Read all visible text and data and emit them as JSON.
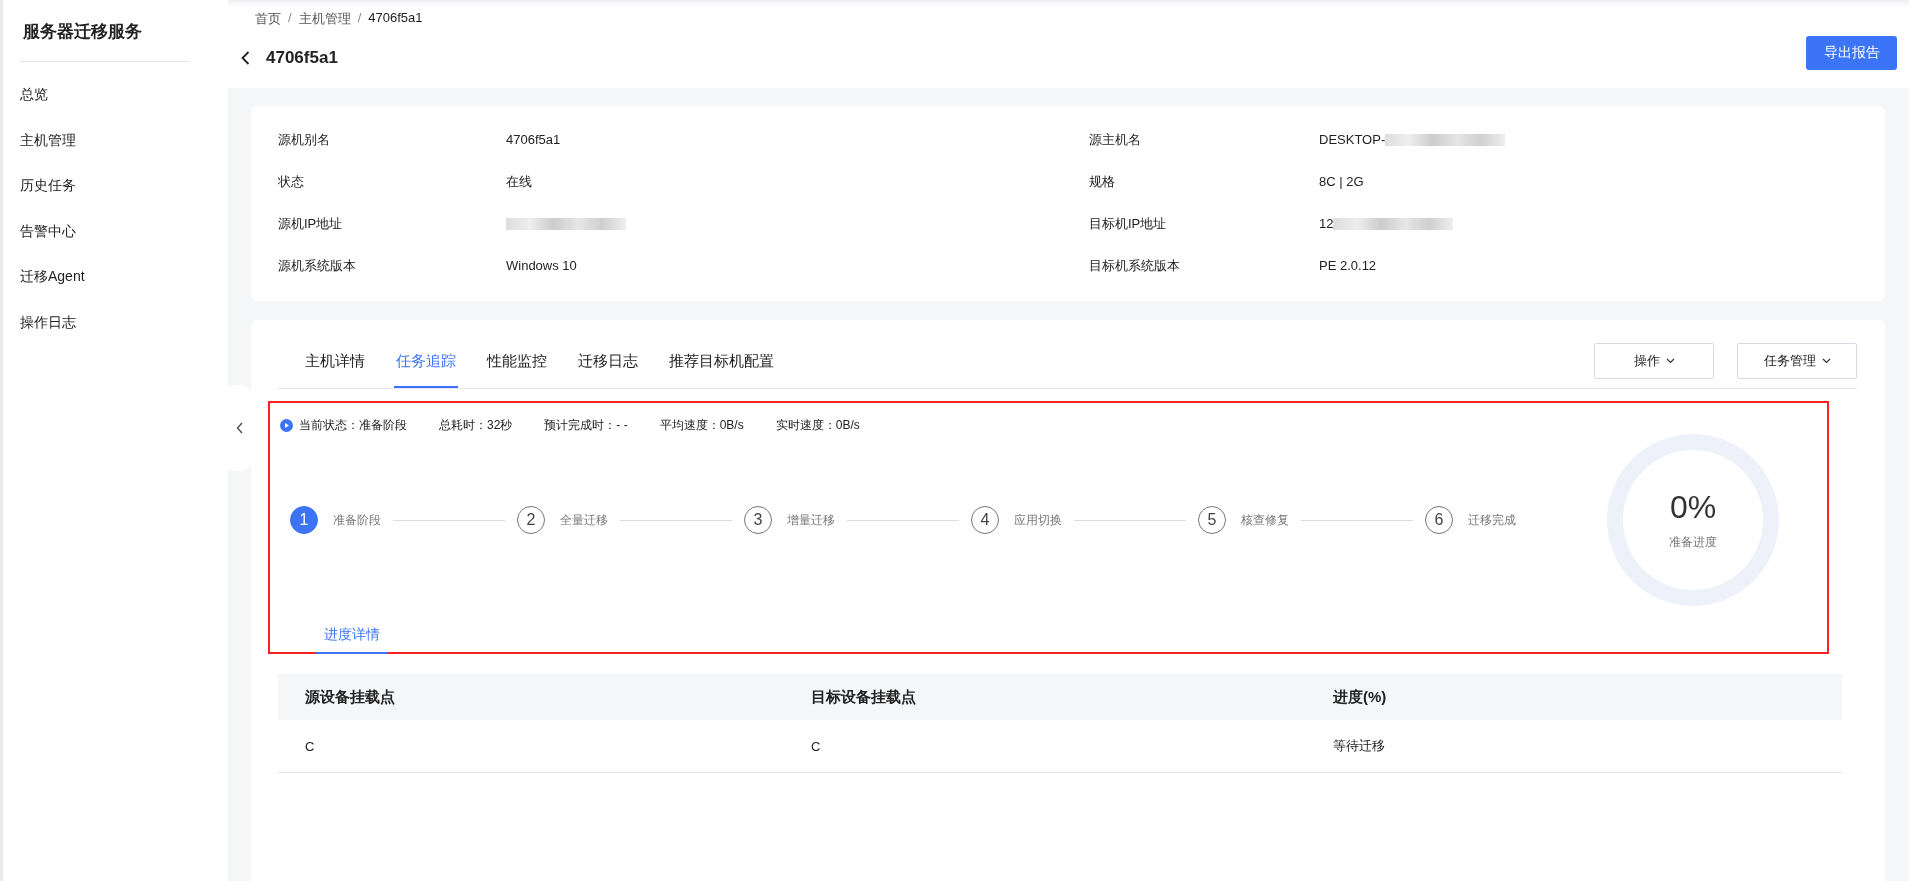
{
  "sidebar": {
    "title": "服务器迁移服务",
    "items": [
      {
        "label": "总览",
        "selected": false
      },
      {
        "label": "主机管理",
        "selected": false
      },
      {
        "label": "历史任务",
        "selected": false
      },
      {
        "label": "告警中心",
        "selected": false
      },
      {
        "label": "迁移Agent",
        "selected": false
      },
      {
        "label": "操作日志",
        "selected": false
      }
    ]
  },
  "breadcrumb": [
    "首页",
    "主机管理",
    "4706f5a1"
  ],
  "breadcrumb_separator": "/",
  "page_title": "4706f5a1",
  "export_button": "导出报告",
  "info": [
    {
      "label": "源机别名",
      "value": "4706f5a1"
    },
    {
      "label": "源主机名",
      "value": "DESKTOP-",
      "redacted": true
    },
    {
      "label": "状态",
      "value": "在线"
    },
    {
      "label": "规格",
      "value": "8C | 2G"
    },
    {
      "label": "源机IP地址",
      "redacted": true
    },
    {
      "label": "目标机IP地址",
      "value": "12",
      "redacted": true
    },
    {
      "label": "源机系统版本",
      "value": "Windows 10"
    },
    {
      "label": "目标机系统版本",
      "value": "PE 2.0.12"
    }
  ],
  "tabs": [
    {
      "label": "主机详情",
      "selected": false
    },
    {
      "label": "任务追踪",
      "selected": true
    },
    {
      "label": "性能监控",
      "selected": false
    },
    {
      "label": "迁移日志",
      "selected": false
    },
    {
      "label": "推荐目标机配置",
      "selected": false
    }
  ],
  "tab_actions": [
    "操作",
    "任务管理"
  ],
  "task_panel": {
    "highlight": true,
    "status": [
      {
        "label": "当前状态：",
        "value": "准备阶段"
      },
      {
        "label": "总耗时：",
        "value": "32秒"
      },
      {
        "label": "预计完成时：",
        "value": "- -"
      },
      {
        "label": "平均速度：",
        "value": "0B/s"
      },
      {
        "label": "实时速度：",
        "value": "0B/s"
      }
    ],
    "steps": [
      {
        "number": "1",
        "label": "准备阶段",
        "selected": true
      },
      {
        "number": "2",
        "label": "全量迁移",
        "selected": false
      },
      {
        "number": "3",
        "label": "增量迁移",
        "selected": false
      },
      {
        "number": "4",
        "label": "应用切换",
        "selected": false
      },
      {
        "number": "5",
        "label": "核查修复",
        "selected": false
      },
      {
        "number": "6",
        "label": "迁移完成",
        "selected": false
      }
    ],
    "progress": {
      "value": "0%",
      "caption": "准备进度"
    }
  },
  "detail_tabs": [
    {
      "label": "进度详情",
      "selected": true
    }
  ],
  "table": {
    "columns": [
      "源设备挂载点",
      "目标设备挂载点",
      "进度(%)"
    ],
    "rows": [
      [
        "C",
        "C",
        "等待迁移"
      ]
    ]
  }
}
